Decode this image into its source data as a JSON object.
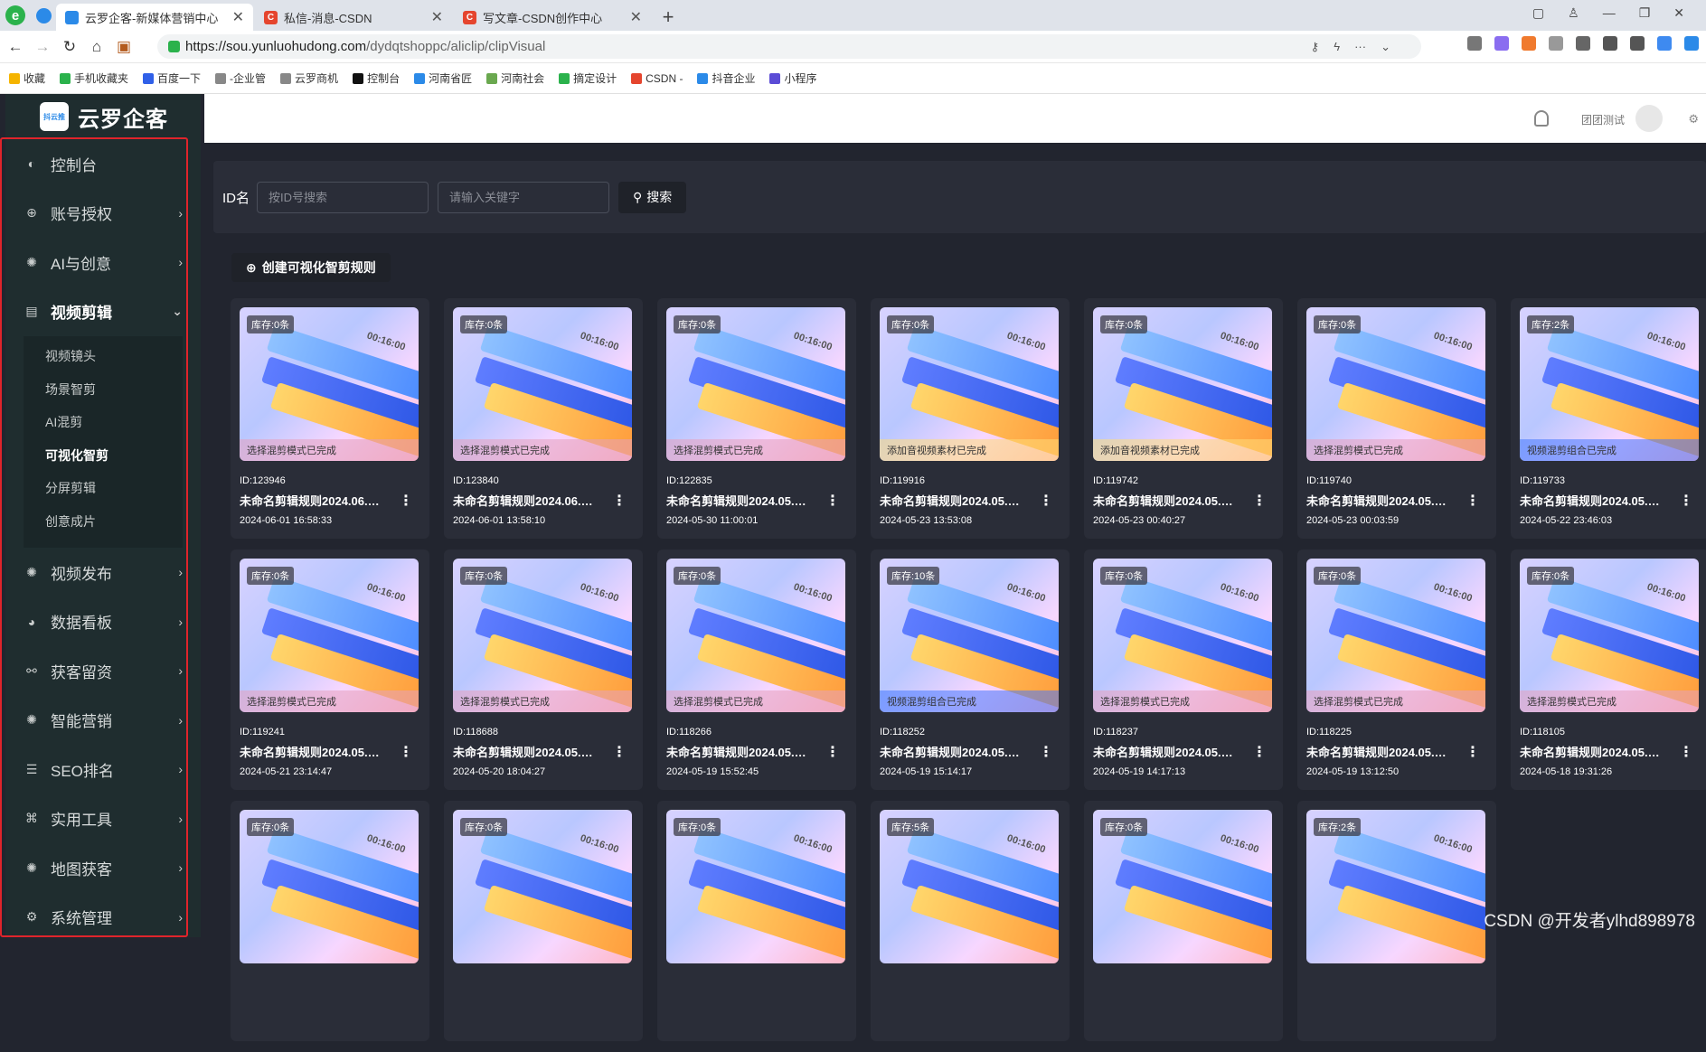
{
  "browser": {
    "tabs": [
      {
        "title": "云罗企客-新媒体营销中心",
        "color": "#2b8ae8",
        "active": true
      },
      {
        "title": "私信-消息-CSDN",
        "color": "#e5452e",
        "active": false
      },
      {
        "title": "写文章-CSDN创作中心",
        "color": "#e5452e",
        "active": false
      }
    ],
    "url_host": "https://sou.yunluohudong.com",
    "url_path": "/dydqtshoppc/aliclip/clipVisual",
    "bookmarks": [
      "收藏",
      "手机收藏夹",
      "百度一下",
      "-企业管",
      "云罗商机",
      "控制台",
      "河南省匠",
      "河南社会",
      "摘定设计",
      "CSDN -",
      "抖音企业",
      "小程序"
    ]
  },
  "sidebar": {
    "brand": "云罗企客",
    "logo_text": "抖云推",
    "items": [
      {
        "label": "控制台",
        "icon": "dashboard-icon",
        "glyph": "◐"
      },
      {
        "label": "账号授权",
        "icon": "target-icon",
        "glyph": "⊕"
      },
      {
        "label": "AI与创意",
        "icon": "ai-icon",
        "glyph": "✺"
      },
      {
        "label": "视频剪辑",
        "icon": "film-icon",
        "glyph": "▤"
      },
      {
        "label": "视频发布",
        "icon": "publish-icon",
        "glyph": "✺"
      },
      {
        "label": "数据看板",
        "icon": "pie-chart-icon",
        "glyph": "◕"
      },
      {
        "label": "获客留资",
        "icon": "sitemap-icon",
        "glyph": "⚯"
      },
      {
        "label": "智能营销",
        "icon": "marketing-icon",
        "glyph": "✺"
      },
      {
        "label": "SEO排名",
        "icon": "sort-icon",
        "glyph": "☰"
      },
      {
        "label": "实用工具",
        "icon": "tools-icon",
        "glyph": "⌘"
      },
      {
        "label": "地图获客",
        "icon": "map-icon",
        "glyph": "✺"
      },
      {
        "label": "系统管理",
        "icon": "settings-icon",
        "glyph": "⚙"
      }
    ],
    "submenu": [
      "视频镜头",
      "场景智剪",
      "AI混剪",
      "可视化智剪",
      "分屏剪辑",
      "创意成片"
    ],
    "active_sub": "可视化智剪"
  },
  "header": {
    "username": "团团测试"
  },
  "search": {
    "label": "ID名",
    "id_placeholder": "按ID号搜索",
    "kw_placeholder": "请输入关键字",
    "button": "搜索"
  },
  "create_button": "创建可视化智剪规则",
  "timecode": "00:16:00",
  "cards": [
    {
      "badge": "库存:0条",
      "status": "选择混剪模式已完成",
      "id": "ID:123946",
      "name": "未命名剪辑规则2024.06.…",
      "date": "2024-06-01 16:58:33"
    },
    {
      "badge": "库存:0条",
      "status": "选择混剪模式已完成",
      "id": "ID:123840",
      "name": "未命名剪辑规则2024.06.…",
      "date": "2024-06-01 13:58:10"
    },
    {
      "badge": "库存:0条",
      "status": "选择混剪模式已完成",
      "id": "ID:122835",
      "name": "未命名剪辑规则2024.05.…",
      "date": "2024-05-30 11:00:01"
    },
    {
      "badge": "库存:0条",
      "status": "添加音视频素材已完成",
      "id": "ID:119916",
      "name": "未命名剪辑规则2024.05.…",
      "date": "2024-05-23 13:53:08"
    },
    {
      "badge": "库存:0条",
      "status": "添加音视频素材已完成",
      "id": "ID:119742",
      "name": "未命名剪辑规则2024.05.…",
      "date": "2024-05-23 00:40:27"
    },
    {
      "badge": "库存:0条",
      "status": "选择混剪模式已完成",
      "id": "ID:119740",
      "name": "未命名剪辑规则2024.05.…",
      "date": "2024-05-23 00:03:59"
    },
    {
      "badge": "库存:2条",
      "status": "视频混剪组合已完成",
      "id": "ID:119733",
      "name": "未命名剪辑规则2024.05.…",
      "date": "2024-05-22 23:46:03"
    },
    {
      "badge": "库存:0条",
      "status": "选择混剪模式已完成",
      "id": "ID:119241",
      "name": "未命名剪辑规则2024.05.…",
      "date": "2024-05-21 23:14:47"
    },
    {
      "badge": "库存:0条",
      "status": "选择混剪模式已完成",
      "id": "ID:118688",
      "name": "未命名剪辑规则2024.05.…",
      "date": "2024-05-20 18:04:27"
    },
    {
      "badge": "库存:0条",
      "status": "选择混剪模式已完成",
      "id": "ID:118266",
      "name": "未命名剪辑规则2024.05.…",
      "date": "2024-05-19 15:52:45"
    },
    {
      "badge": "库存:10条",
      "status": "视频混剪组合已完成",
      "id": "ID:118252",
      "name": "未命名剪辑规则2024.05.…",
      "date": "2024-05-19 15:14:17"
    },
    {
      "badge": "库存:0条",
      "status": "选择混剪模式已完成",
      "id": "ID:118237",
      "name": "未命名剪辑规则2024.05.…",
      "date": "2024-05-19 14:17:13"
    },
    {
      "badge": "库存:0条",
      "status": "选择混剪模式已完成",
      "id": "ID:118225",
      "name": "未命名剪辑规则2024.05.…",
      "date": "2024-05-19 13:12:50"
    },
    {
      "badge": "库存:0条",
      "status": "选择混剪模式已完成",
      "id": "ID:118105",
      "name": "未命名剪辑规则2024.05.…",
      "date": "2024-05-18 19:31:26"
    },
    {
      "badge": "库存:0条",
      "status": "",
      "id": "",
      "name": "",
      "date": ""
    },
    {
      "badge": "库存:0条",
      "status": "",
      "id": "",
      "name": "",
      "date": ""
    },
    {
      "badge": "库存:0条",
      "status": "",
      "id": "",
      "name": "",
      "date": ""
    },
    {
      "badge": "库存:5条",
      "status": "",
      "id": "",
      "name": "",
      "date": ""
    },
    {
      "badge": "库存:0条",
      "status": "",
      "id": "",
      "name": "",
      "date": ""
    },
    {
      "badge": "库存:2条",
      "status": "",
      "id": "",
      "name": "",
      "date": ""
    }
  ],
  "watermark": "CSDN @开发者ylhd898978"
}
